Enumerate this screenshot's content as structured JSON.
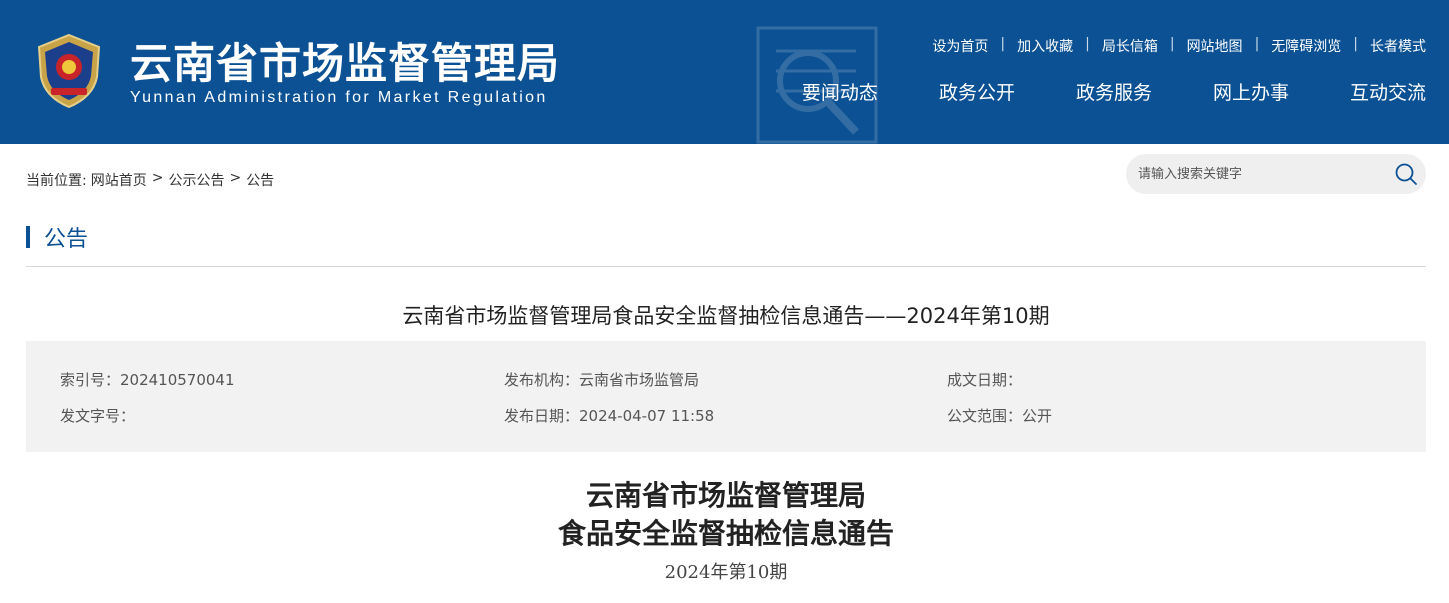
{
  "header": {
    "title": "云南省市场监督管理局",
    "subtitle": "Yunnan Administration for Market Regulation",
    "top_links": [
      "设为首页",
      "加入收藏",
      "局长信箱",
      "网站地图",
      "无障碍浏览",
      "长者模式"
    ],
    "top_link_separator": "|",
    "nav": [
      "要闻动态",
      "政务公开",
      "政务服务",
      "网上办事",
      "互动交流"
    ],
    "colors": {
      "brand_blue": "#0b5193"
    }
  },
  "breadcrumb": {
    "prefix": "当前位置:",
    "items": [
      "网站首页",
      "公示公告",
      "公告"
    ],
    "separator": ">"
  },
  "search": {
    "placeholder": "请输入搜索关键字",
    "icon": "search-icon"
  },
  "section": {
    "title": "公告"
  },
  "article": {
    "title": "云南省市场监督管理局食品安全监督抽检信息通告——2024年第10期",
    "meta": {
      "index_no": "索引号：202410570041",
      "publisher": "发布机构：云南省市场监管局",
      "created_date": "成文日期：",
      "doc_number": "发文字号：",
      "publish_date": "发布日期：2024-04-07 11:58",
      "scope": "公文范围：公开"
    },
    "heading_line1": "云南省市场监督管理局",
    "heading_line2": "食品安全监督抽检信息通告",
    "issue": "2024年第10期"
  }
}
